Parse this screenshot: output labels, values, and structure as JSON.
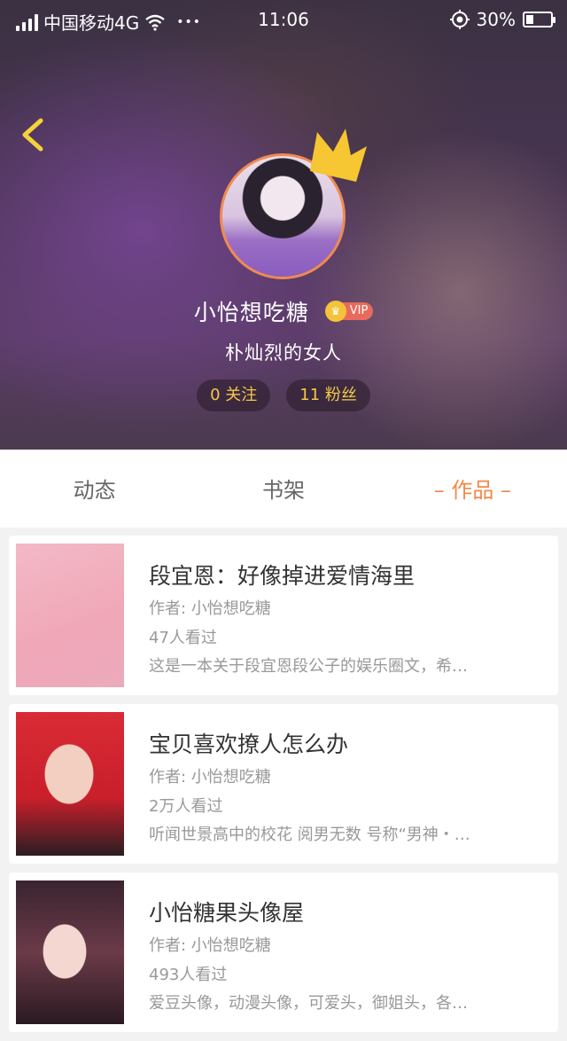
{
  "status_bar": {
    "carrier": "中国移动4G",
    "dots": "•••",
    "time": "11:06",
    "battery": "30%",
    "battery_level": 0.3
  },
  "profile": {
    "username": "小怡想吃糖",
    "vip_label": "VIP",
    "signature": "朴灿烈的女人",
    "following": "0 关注",
    "followers": "11 粉丝"
  },
  "tabs": [
    {
      "label": "动态",
      "active": false
    },
    {
      "label": "书架",
      "active": false
    },
    {
      "label": "– 作品 –",
      "active": true
    }
  ],
  "works": [
    {
      "title": "段宜恩：好像掉进爱情海里",
      "author": "作者: 小怡想吃糖",
      "views": "47人看过",
      "desc": "这是一本关于段宜恩段公子的娱乐圈文，希…"
    },
    {
      "title": "宝贝喜欢撩人怎么办",
      "author": "作者: 小怡想吃糖",
      "views": "2万人看过",
      "desc": "听闻世景高中的校花 阅男无数 号称“男神・…"
    },
    {
      "title": "小怡糖果头像屋",
      "author": "作者: 小怡想吃糖",
      "views": "493人看过",
      "desc": "爱豆头像，动漫头像，可爱头，御姐头，各…"
    }
  ],
  "colors": {
    "accent": "#f08a4b",
    "stat_text": "#f4c74a",
    "vip_red": "#e76a5c",
    "crown": "#f6c633"
  }
}
